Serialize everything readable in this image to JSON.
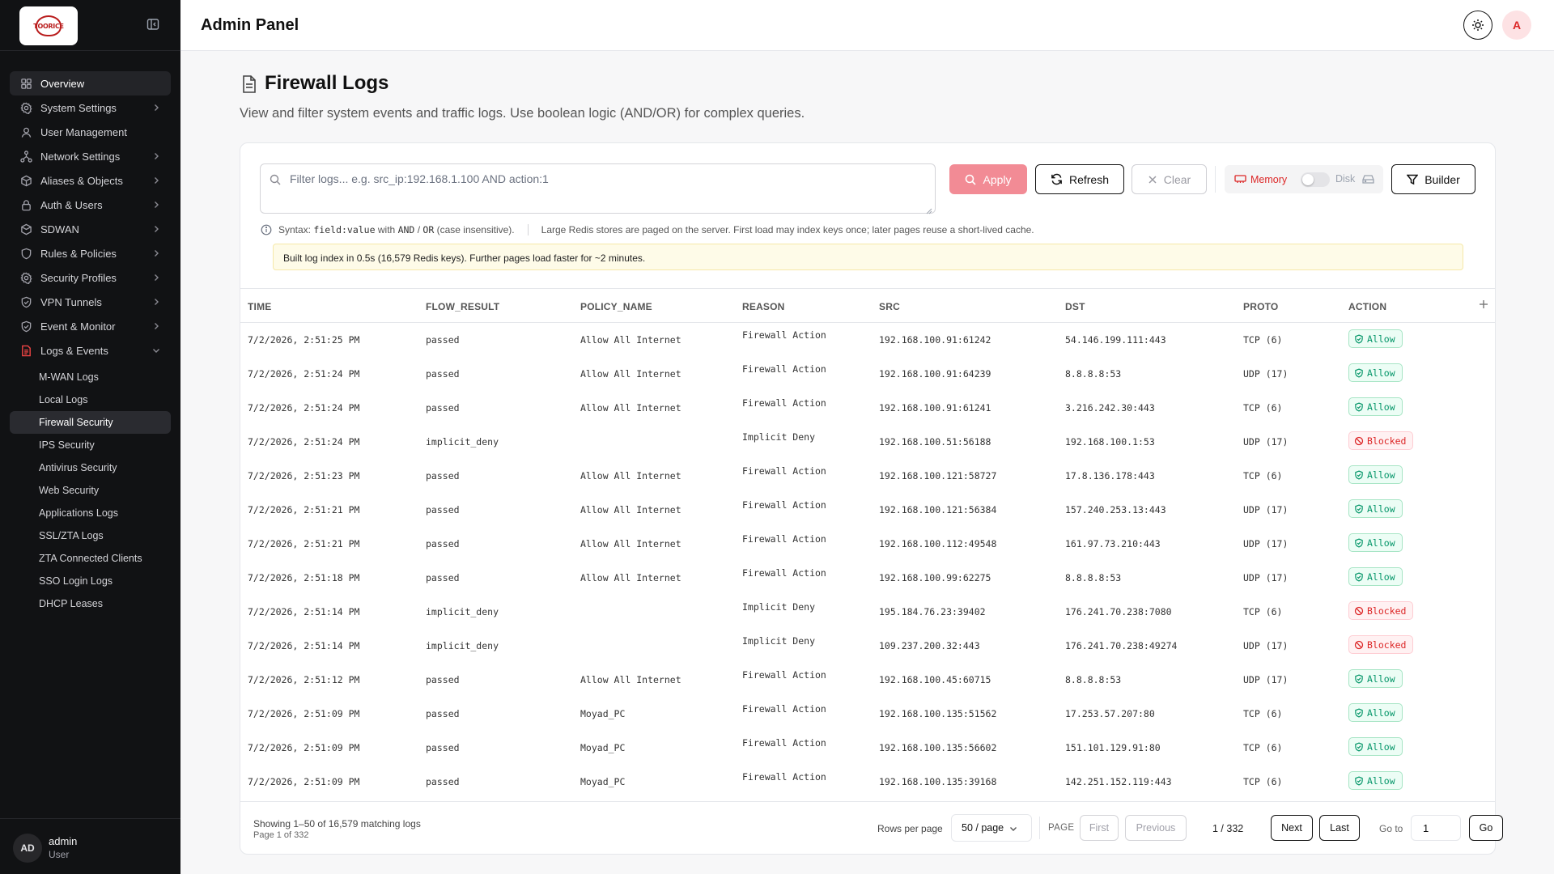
{
  "sidebar": {
    "logo_text": "TOORICE",
    "nav": [
      {
        "label": "Overview",
        "icon": "grid-icon",
        "chevron": false,
        "active": true
      },
      {
        "label": "System Settings",
        "icon": "gear-icon",
        "chevron": true
      },
      {
        "label": "User Management",
        "icon": "user-icon",
        "chevron": false
      },
      {
        "label": "Network Settings",
        "icon": "network-icon",
        "chevron": true
      },
      {
        "label": "Aliases & Objects",
        "icon": "cube-icon",
        "chevron": true
      },
      {
        "label": "Auth & Users",
        "icon": "lock-icon",
        "chevron": true
      },
      {
        "label": "SDWAN",
        "icon": "box-icon",
        "chevron": true
      },
      {
        "label": "Rules & Policies",
        "icon": "shield-icon",
        "chevron": true
      },
      {
        "label": "Security Profiles",
        "icon": "gear-icon",
        "chevron": true
      },
      {
        "label": "VPN Tunnels",
        "icon": "shield-check-icon",
        "chevron": true
      },
      {
        "label": "Event & Monitor",
        "icon": "shield-check-icon",
        "chevron": true
      },
      {
        "label": "Logs & Events",
        "icon": "log-file-icon",
        "chevron": true
      }
    ],
    "sub_items": [
      {
        "label": "M-WAN Logs"
      },
      {
        "label": "Local Logs"
      },
      {
        "label": "Firewall Security",
        "active": true
      },
      {
        "label": "IPS Security"
      },
      {
        "label": "Antivirus Security"
      },
      {
        "label": "Web Security"
      },
      {
        "label": "Applications Logs"
      },
      {
        "label": "SSL/ZTA Logs"
      },
      {
        "label": "ZTA Connected Clients"
      },
      {
        "label": "SSO Login Logs"
      },
      {
        "label": "DHCP Leases"
      }
    ],
    "user": {
      "initials": "AD",
      "name": "admin",
      "role": "User"
    }
  },
  "header": {
    "title": "Admin Panel",
    "user_initial": "A"
  },
  "page": {
    "title": "Firewall Logs",
    "subtitle": "View and filter system events and traffic logs. Use boolean logic (AND/OR) for complex queries."
  },
  "toolbar": {
    "filter_placeholder": "Filter logs... e.g. src_ip:192.168.1.100 AND action:1",
    "filter_value": "",
    "apply_label": "Apply",
    "refresh_label": "Refresh",
    "clear_label": "Clear",
    "memory_label": "Memory",
    "disk_label": "Disk",
    "builder_label": "Builder"
  },
  "hints": {
    "syntax_prefix": "Syntax:",
    "syntax_code": "field:value",
    "syntax_mid": "with",
    "syntax_and": "AND",
    "syntax_slash": "/",
    "syntax_or": "OR",
    "syntax_suffix": "(case insensitive).",
    "paging_note": "Large Redis stores are paged on the server. First load may index keys once; later pages reuse a short-lived cache.",
    "index_notice": "Built log index in 0.5s (16,579 Redis keys). Further pages load faster for ~2 minutes."
  },
  "table": {
    "columns": [
      "TIME",
      "FLOW_RESULT",
      "POLICY_NAME",
      "REASON",
      "SRC",
      "DST",
      "PROTO",
      "ACTION"
    ],
    "rows": [
      {
        "time": "7/2/2026, 2:51:25 PM",
        "flow": "passed",
        "policy": "Allow All Internet",
        "reason": "Firewall Action",
        "src": "192.168.100.91:61242",
        "dst": "54.146.199.111:443",
        "proto": "TCP (6)",
        "action": "Allow"
      },
      {
        "time": "7/2/2026, 2:51:24 PM",
        "flow": "passed",
        "policy": "Allow All Internet",
        "reason": "Firewall Action",
        "src": "192.168.100.91:64239",
        "dst": "8.8.8.8:53",
        "proto": "UDP (17)",
        "action": "Allow"
      },
      {
        "time": "7/2/2026, 2:51:24 PM",
        "flow": "passed",
        "policy": "Allow All Internet",
        "reason": "Firewall Action",
        "src": "192.168.100.91:61241",
        "dst": "3.216.242.30:443",
        "proto": "TCP (6)",
        "action": "Allow"
      },
      {
        "time": "7/2/2026, 2:51:24 PM",
        "flow": "implicit_deny",
        "policy": "",
        "reason": "Implicit Deny",
        "src": "192.168.100.51:56188",
        "dst": "192.168.100.1:53",
        "proto": "UDP (17)",
        "action": "Blocked"
      },
      {
        "time": "7/2/2026, 2:51:23 PM",
        "flow": "passed",
        "policy": "Allow All Internet",
        "reason": "Firewall Action",
        "src": "192.168.100.121:58727",
        "dst": "17.8.136.178:443",
        "proto": "TCP (6)",
        "action": "Allow"
      },
      {
        "time": "7/2/2026, 2:51:21 PM",
        "flow": "passed",
        "policy": "Allow All Internet",
        "reason": "Firewall Action",
        "src": "192.168.100.121:56384",
        "dst": "157.240.253.13:443",
        "proto": "UDP (17)",
        "action": "Allow"
      },
      {
        "time": "7/2/2026, 2:51:21 PM",
        "flow": "passed",
        "policy": "Allow All Internet",
        "reason": "Firewall Action",
        "src": "192.168.100.112:49548",
        "dst": "161.97.73.210:443",
        "proto": "UDP (17)",
        "action": "Allow"
      },
      {
        "time": "7/2/2026, 2:51:18 PM",
        "flow": "passed",
        "policy": "Allow All Internet",
        "reason": "Firewall Action",
        "src": "192.168.100.99:62275",
        "dst": "8.8.8.8:53",
        "proto": "UDP (17)",
        "action": "Allow"
      },
      {
        "time": "7/2/2026, 2:51:14 PM",
        "flow": "implicit_deny",
        "policy": "",
        "reason": "Implicit Deny",
        "src": "195.184.76.23:39402",
        "dst": "176.241.70.238:7080",
        "proto": "TCP (6)",
        "action": "Blocked"
      },
      {
        "time": "7/2/2026, 2:51:14 PM",
        "flow": "implicit_deny",
        "policy": "",
        "reason": "Implicit Deny",
        "src": "109.237.200.32:443",
        "dst": "176.241.70.238:49274",
        "proto": "UDP (17)",
        "action": "Blocked"
      },
      {
        "time": "7/2/2026, 2:51:12 PM",
        "flow": "passed",
        "policy": "Allow All Internet",
        "reason": "Firewall Action",
        "src": "192.168.100.45:60715",
        "dst": "8.8.8.8:53",
        "proto": "UDP (17)",
        "action": "Allow"
      },
      {
        "time": "7/2/2026, 2:51:09 PM",
        "flow": "passed",
        "policy": "Moyad_PC",
        "reason": "Firewall Action",
        "src": "192.168.100.135:51562",
        "dst": "17.253.57.207:80",
        "proto": "TCP (6)",
        "action": "Allow"
      },
      {
        "time": "7/2/2026, 2:51:09 PM",
        "flow": "passed",
        "policy": "Moyad_PC",
        "reason": "Firewall Action",
        "src": "192.168.100.135:56602",
        "dst": "151.101.129.91:80",
        "proto": "TCP (6)",
        "action": "Allow"
      },
      {
        "time": "7/2/2026, 2:51:09 PM",
        "flow": "passed",
        "policy": "Moyad_PC",
        "reason": "Firewall Action",
        "src": "192.168.100.135:39168",
        "dst": "142.251.152.119:443",
        "proto": "TCP (6)",
        "action": "Allow"
      }
    ]
  },
  "pagination": {
    "showing": "Showing 1–50 of 16,579 matching logs",
    "page_line": "Page 1 of 332",
    "rows_per_page_label": "Rows per page",
    "rows_per_page_value": "50 / page",
    "page_word": "PAGE",
    "first_label": "First",
    "previous_label": "Previous",
    "count": "1 / 332",
    "next_label": "Next",
    "last_label": "Last",
    "goto_label": "Go to",
    "goto_value": "1",
    "go_label": "Go"
  },
  "colors": {
    "accent": "#dc2626",
    "allow": "#059669",
    "sidebar_bg": "#111214"
  }
}
